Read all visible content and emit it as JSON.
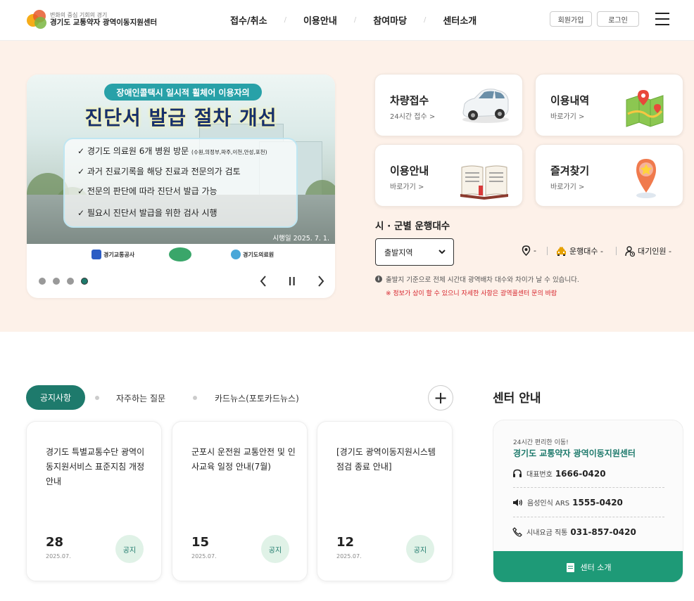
{
  "header": {
    "logo_slogan": "변화의 중심 기회의 경기",
    "logo_name": "경기도 교통약자 광역이동지원센터",
    "nav": [
      "접수/취소",
      "이용안내",
      "참여마당",
      "센터소개"
    ],
    "nav_separator": "/",
    "signup_label": "회원가입",
    "login_label": "로그인"
  },
  "banner": {
    "pill": "장애인콜택시 일시적 휠체어 이용자의",
    "headline": "진단서 발급 절차 개선",
    "checks": [
      {
        "text": "✓ 경기도 의료원 6개 병원 방문",
        "small": "(수원,의정부,파주,이천,안성,포천)"
      },
      {
        "text": "✓ 과거 진료기록을 해당 진료과 전문의가 검토",
        "small": ""
      },
      {
        "text": "✓ 전문의 판단에 따라 진단서 발급 가능",
        "small": ""
      },
      {
        "text": "✓ 필요시 진단서 발급을 위한 검사 시행",
        "small": ""
      }
    ],
    "date": "시행일 2025. 7. 1.",
    "footer_logos": [
      "경기교통공사",
      "변화의 중심 기회의 경기",
      "경기도의료원"
    ],
    "slide_count": 4,
    "active_slide": 4,
    "prev": "‹",
    "pause": "❚❚",
    "next": "›"
  },
  "quick": [
    {
      "title": "차량접수",
      "sub": "24시간 접수 >",
      "icon": "car-icon"
    },
    {
      "title": "이용내역",
      "sub": "바로가기 >",
      "icon": "map-icon"
    },
    {
      "title": "이용안내",
      "sub": "바로가기 >",
      "icon": "book-icon"
    },
    {
      "title": "즐겨찾기",
      "sub": "바로가기 >",
      "icon": "star-pin-icon"
    }
  ],
  "vehicles": {
    "title": "시 · 군별 운행대수",
    "select_value": "출발지역",
    "location_value": "-",
    "running_label": "운행대수",
    "running_value": "-",
    "waiting_label": "대기인원",
    "waiting_value": "-",
    "note": "출발지 기준으로 전체 시간대 광역배차 대수와 차이가 날 수 있습니다.",
    "warning": "※ 정보가 상이 할 수 있으니 자세한 사항은 광역콜센터 문의 바람"
  },
  "notice": {
    "tabs": [
      "공지사항",
      "자주하는 질문",
      "카드뉴스(포토카드뉴스)"
    ],
    "more": "+",
    "cards": [
      {
        "title": "경기도 특별교통수단 광역이동지원서비스 표준지침 개정안내",
        "day": "28",
        "ym": "2025.07.",
        "badge": "공지"
      },
      {
        "title": "군포시 운전원 교통안전 및 인사교육 일정 안내(7월)",
        "day": "15",
        "ym": "2025.07.",
        "badge": "공지"
      },
      {
        "title": "[경기도 광역이동지원시스템 점검 종료 안내]",
        "day": "12",
        "ym": "2025.07.",
        "badge": "공지"
      }
    ]
  },
  "center": {
    "title": "센터 안내",
    "sub": "24시간 편리한 이동!",
    "name": "경기도 교통약자 광역이동지원센터",
    "rows": [
      {
        "label": "대표번호",
        "value": "1666-0420",
        "icon": "headset-icon"
      },
      {
        "label": "음성인식 ARS",
        "value": "1555-0420",
        "icon": "speaker-icon"
      },
      {
        "label": "시내요금 직통",
        "value": "031-857-0420",
        "icon": "phone-icon"
      }
    ],
    "button": "센터 소개"
  },
  "colors": {
    "brand_green": "#1e7a6c",
    "hero_bg": "#fdf1e9",
    "warning_red": "#d6222a"
  }
}
